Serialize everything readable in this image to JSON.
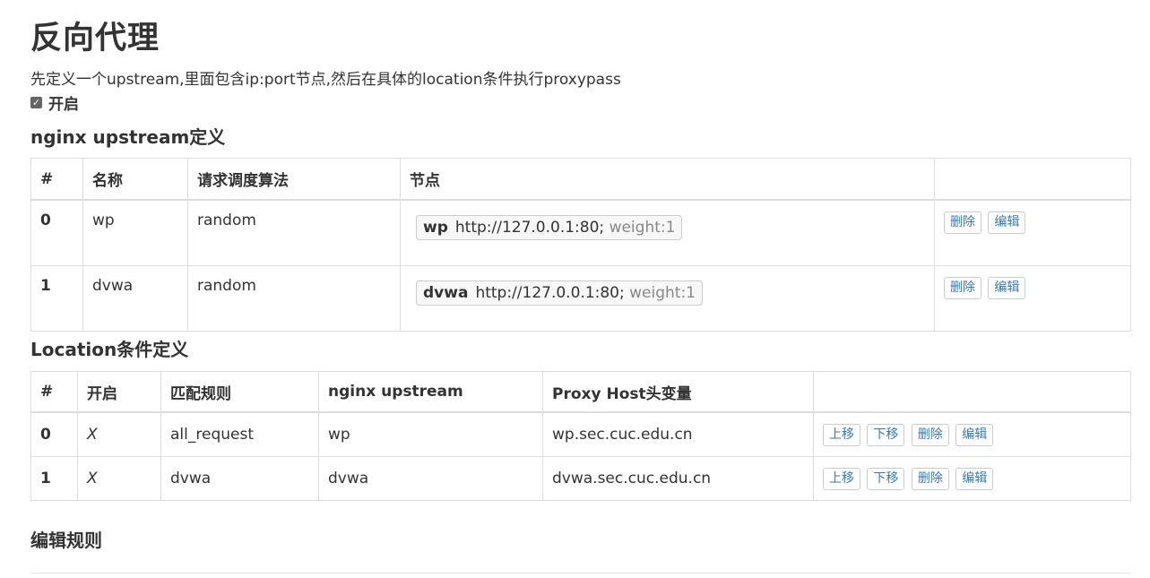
{
  "title": "反向代理",
  "description": "先定义一个upstream,里面包含ip:port节点,然后在具体的location条件执行proxypass",
  "enable_label": "开启",
  "upstream_section": {
    "heading": "nginx upstream定义",
    "headers": [
      "#",
      "名称",
      "请求调度算法",
      "节点",
      ""
    ],
    "rows": [
      {
        "index": "0",
        "name": "wp",
        "algo": "random",
        "node_name": "wp",
        "node_url": "http://127.0.0.1:80;",
        "node_weight": "weight:1",
        "delete": "删除",
        "edit": "编辑"
      },
      {
        "index": "1",
        "name": "dvwa",
        "algo": "random",
        "node_name": "dvwa",
        "node_url": "http://127.0.0.1:80;",
        "node_weight": "weight:1",
        "delete": "删除",
        "edit": "编辑"
      }
    ]
  },
  "location_section": {
    "heading": "Location条件定义",
    "headers": [
      "#",
      "开启",
      "匹配规则",
      "nginx upstream",
      "Proxy Host头变量",
      ""
    ],
    "rows": [
      {
        "index": "0",
        "enabled": "X",
        "rule": "all_request",
        "upstream": "wp",
        "host": "wp.sec.cuc.edu.cn",
        "up": "上移",
        "down": "下移",
        "delete": "删除",
        "edit": "编辑"
      },
      {
        "index": "1",
        "enabled": "X",
        "rule": "dvwa",
        "upstream": "dvwa",
        "host": "dvwa.sec.cuc.edu.cn",
        "up": "上移",
        "down": "下移",
        "delete": "删除",
        "edit": "编辑"
      }
    ]
  },
  "edit_section": {
    "heading": "编辑规则"
  }
}
